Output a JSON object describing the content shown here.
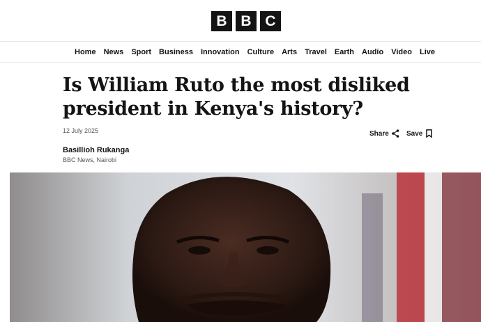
{
  "brand": {
    "logo_letters": [
      "B",
      "B",
      "C"
    ]
  },
  "nav": {
    "items": [
      "Home",
      "News",
      "Sport",
      "Business",
      "Innovation",
      "Culture",
      "Arts",
      "Travel",
      "Earth",
      "Audio",
      "Video",
      "Live"
    ]
  },
  "article": {
    "headline": "Is William Ruto the most disliked president in Kenya's history?",
    "date": "12 July 2025",
    "author_name": "Basillioh Rukanga",
    "author_org": "BBC News, Nairobi"
  },
  "actions": {
    "share_label": "Share",
    "save_label": "Save"
  },
  "icons": {
    "share": "share-icon",
    "save": "bookmark-icon"
  },
  "colors": {
    "text": "#141414",
    "muted": "#545658",
    "divider": "#e6e6e6"
  }
}
